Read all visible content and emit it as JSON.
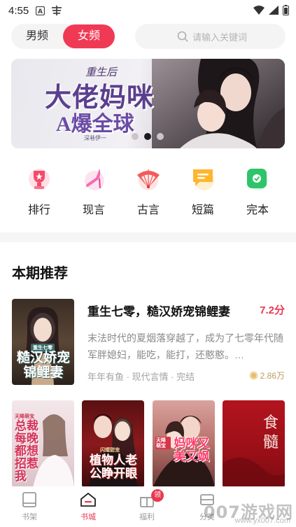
{
  "status_bar": {
    "time": "4:55"
  },
  "header": {
    "channel_male": "男频",
    "channel_female": "女频",
    "search_placeholder": "请输入关键词"
  },
  "banner": {
    "subtitle": "重生后",
    "title_line1": "大佬妈咪",
    "title_line2": "A爆全球",
    "author": "深巷伊一",
    "slides": 3,
    "active_slide": 2
  },
  "categories": [
    {
      "label": "排行",
      "icon": "trophy-icon"
    },
    {
      "label": "现言",
      "icon": "high-heel-icon"
    },
    {
      "label": "古言",
      "icon": "folding-fan-icon"
    },
    {
      "label": "短篇",
      "icon": "short-note-icon"
    },
    {
      "label": "完本",
      "icon": "complete-check-icon"
    }
  ],
  "section_title": "本期推荐",
  "featured_book": {
    "title": "重生七零，糙汉娇宠锦鲤妻",
    "score": "7.2分",
    "description": "末法时代的夏烟落穿越了，成为了七零年代随军胖媳妇，能吃，能打，还憨憨。…",
    "meta": "年年有鱼 · 现代言情 · 完结",
    "heat": "2.86万",
    "cover_text": "糙汉娇宠锦鲤妻",
    "cover_tag": "重生七零"
  },
  "grid_books": [
    {
      "cover_text": "总裁每晚都想招惹我",
      "cover_tag": "天降萌宝"
    },
    {
      "cover_text": "植物人老公睁开眼",
      "cover_tag": "闪婚甜宠"
    },
    {
      "cover_text": "妈咪又美又飒",
      "cover_tag": "天降萌宝"
    },
    {
      "cover_text": "食髓"
    }
  ],
  "bottom_nav": {
    "items": [
      {
        "label": "书架",
        "icon": "bookshelf-icon",
        "active": false
      },
      {
        "label": "书城",
        "icon": "home-icon",
        "active": true
      },
      {
        "label": "福利",
        "icon": "gift-icon",
        "active": false,
        "badge": "领"
      },
      {
        "label": "分类",
        "icon": "category-icon",
        "active": false
      }
    ]
  },
  "watermark": {
    "text": "007游戏网",
    "sub": "www.yx007.com"
  },
  "colors": {
    "accent": "#f03a55",
    "score": "#e8394f"
  }
}
